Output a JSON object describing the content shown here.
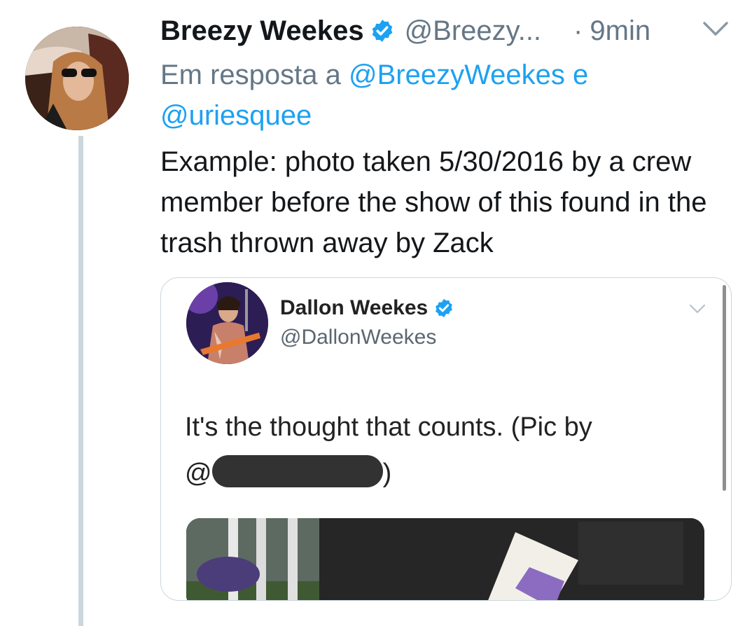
{
  "tweet": {
    "author_name": "Breezy Weekes",
    "author_handle": "@Breezy...",
    "time_separator": "·",
    "time": "9min",
    "reply_prefix": "Em resposta a",
    "reply_mention_1": "@BreezyWeekes",
    "reply_conjunction": "e",
    "reply_mention_2": "@uriesquee",
    "text": "Example: photo taken 5/30/2016 by a crew member before the show of this found in the trash thrown away by Zack"
  },
  "quoted": {
    "author_name": "Dallon Weekes",
    "author_handle": "@DallonWeekes",
    "text_line1": "It's the thought that counts. (Pic by",
    "mention_prefix": "@",
    "mention_suffix": ")"
  },
  "icons": {
    "verified": "verified-badge-icon",
    "chevron": "chevron-down-icon"
  },
  "colors": {
    "link": "#1da1f2",
    "secondary_text": "#657786",
    "verified": "#1da1f2",
    "thread_line": "#ccd6dd"
  }
}
